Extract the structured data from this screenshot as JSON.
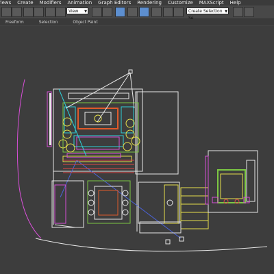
{
  "menu": {
    "items": [
      "Views",
      "Create",
      "Modifiers",
      "Animation",
      "Graph Editors",
      "Rendering",
      "Customize",
      "MAXScript",
      "Help"
    ]
  },
  "toolbar": {
    "view_dropdown": "View",
    "selection_set_placeholder": "Create Selection Se"
  },
  "ribbon": {
    "tabs": [
      "Freeform",
      "Selection",
      "Object Paint"
    ]
  },
  "colors": {
    "viewport_bg": "#3d3d3d",
    "wire_white": "#e8e8e8",
    "wire_green": "#7cc843",
    "wire_yellow": "#e6e04a",
    "wire_magenta": "#d84fd8",
    "wire_cyan": "#2fd0d8",
    "wire_red": "#e04848",
    "wire_blue": "#4a62d8"
  },
  "icons": [
    "undo-icon",
    "redo-icon",
    "link-icon",
    "unlink-icon",
    "select-icon",
    "select-region-icon",
    "move-icon",
    "rotate-icon",
    "scale-icon",
    "snap-icon",
    "angle-snap-icon",
    "percent-snap-icon",
    "mirror-icon",
    "align-icon",
    "render-icon",
    "material-editor-icon"
  ]
}
